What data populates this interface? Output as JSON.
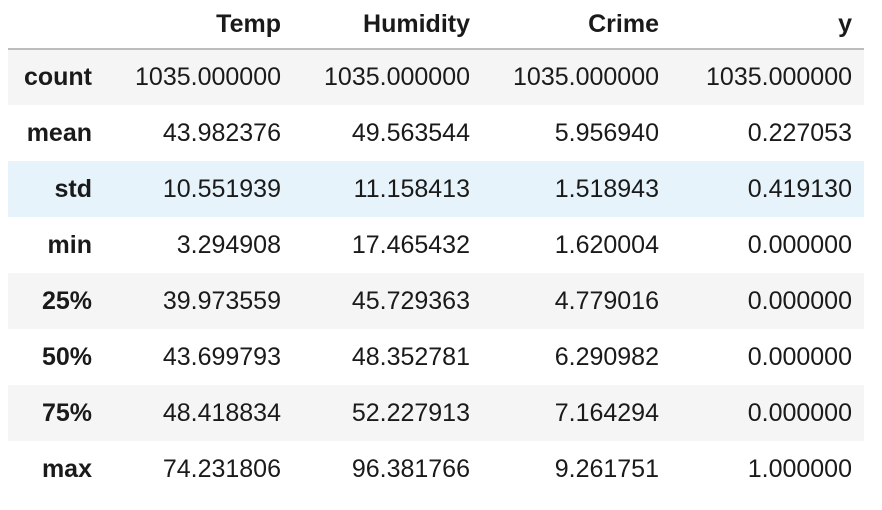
{
  "table": {
    "columns": [
      "Temp",
      "Humidity",
      "Crime",
      "y"
    ],
    "rows": [
      {
        "index": "count",
        "values": [
          "1035.000000",
          "1035.000000",
          "1035.000000",
          "1035.000000"
        ]
      },
      {
        "index": "mean",
        "values": [
          "43.982376",
          "49.563544",
          "5.956940",
          "0.227053"
        ]
      },
      {
        "index": "std",
        "values": [
          "10.551939",
          "11.158413",
          "1.518943",
          "0.419130"
        ]
      },
      {
        "index": "min",
        "values": [
          "3.294908",
          "17.465432",
          "1.620004",
          "0.000000"
        ]
      },
      {
        "index": "25%",
        "values": [
          "39.973559",
          "45.729363",
          "4.779016",
          "0.000000"
        ]
      },
      {
        "index": "50%",
        "values": [
          "43.699793",
          "48.352781",
          "6.290982",
          "0.000000"
        ]
      },
      {
        "index": "75%",
        "values": [
          "48.418834",
          "52.227913",
          "7.164294",
          "0.000000"
        ]
      },
      {
        "index": "max",
        "values": [
          "74.231806",
          "96.381766",
          "9.261751",
          "1.000000"
        ]
      }
    ],
    "highlighted_row": "std"
  },
  "colors": {
    "row_stripe": "#f5f5f5",
    "row_hover": "#e6f3fb",
    "header_border": "#bdbdbd"
  }
}
